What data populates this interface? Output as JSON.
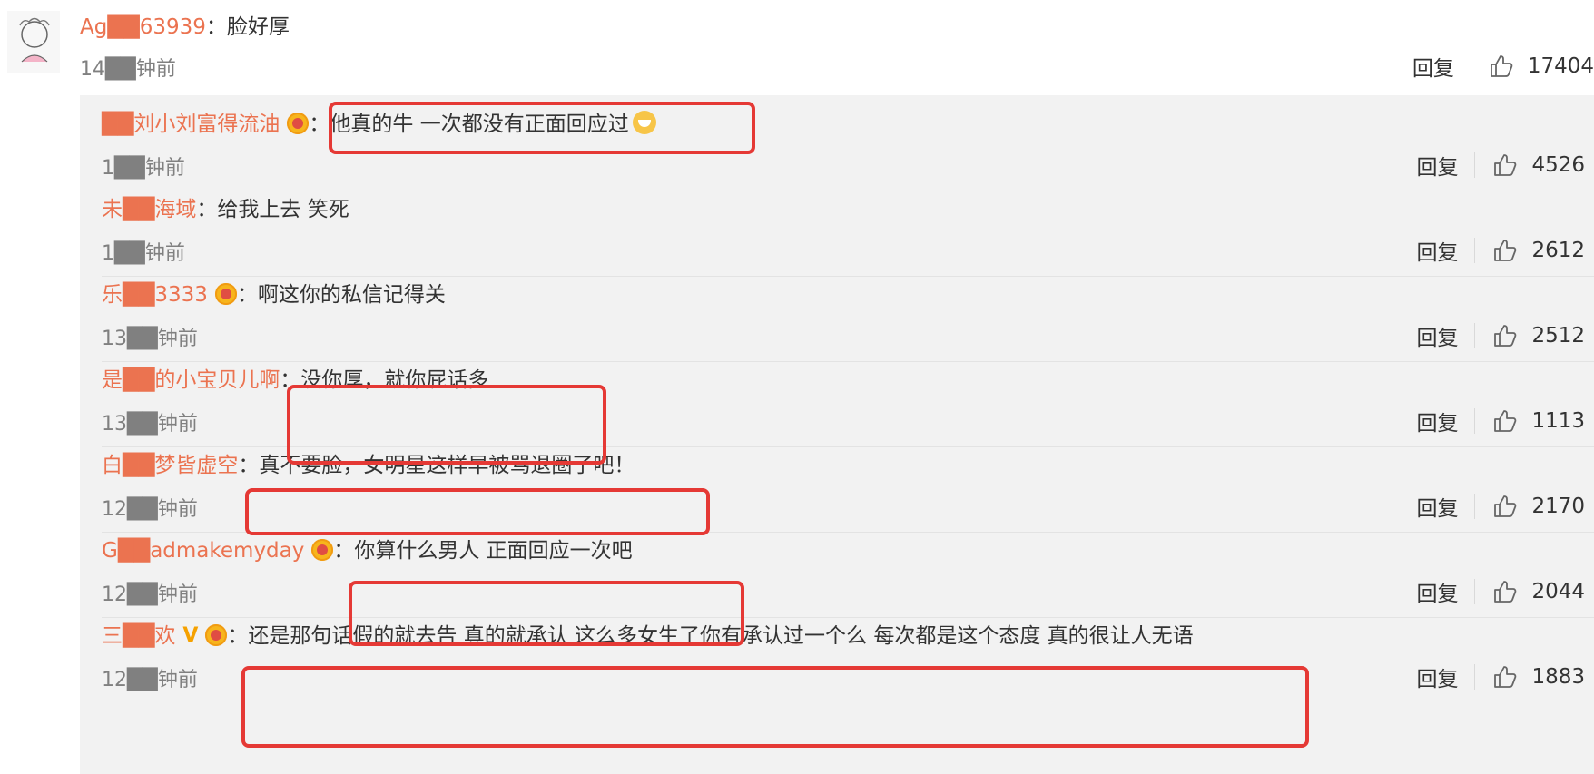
{
  "top_comment": {
    "username": "Ag██63939",
    "colon": "：",
    "content": "脸好厚",
    "time": "14██钟前",
    "reply_label": "回复",
    "likes": "17404"
  },
  "replies": [
    {
      "username": "██刘小刘富得流油",
      "colon": "：",
      "content": "他真的牛 一次都没有正面回应过",
      "time": "1██钟前",
      "reply_label": "回复",
      "likes": "4526",
      "badge": "crown-badge",
      "emoji": "sweat-smile-emoji"
    },
    {
      "username": "未██海域",
      "colon": "：",
      "content": "给我上去 笑死",
      "time": "1██钟前",
      "reply_label": "回复",
      "likes": "2612"
    },
    {
      "username": "乐██3333",
      "colon": "：",
      "content": "啊这你的私信记得关",
      "time": "13██钟前",
      "reply_label": "回复",
      "likes": "2512",
      "badge": "crown-badge"
    },
    {
      "username": "是██的小宝贝儿啊",
      "colon": "：",
      "content": "没你厚，就你屁话多",
      "time": "13██钟前",
      "reply_label": "回复",
      "likes": "1113"
    },
    {
      "username": "白██梦皆虚空",
      "colon": "：",
      "content": "真不要脸，女明星这样早被骂退圈了吧！",
      "time": "12██钟前",
      "reply_label": "回复",
      "likes": "2170"
    },
    {
      "username": "G██admakemyday",
      "colon": "：",
      "content": "你算什么男人 正面回应一次吧",
      "time": "12██钟前",
      "reply_label": "回复",
      "likes": "2044",
      "badge": "crown-badge"
    },
    {
      "username": "三██欢",
      "colon": "：",
      "content": "还是那句话假的就去告 真的就承认 这么多女生了你有承认过一个么 每次都是这个态度 真的很让人无语",
      "time": "12██钟前",
      "reply_label": "回复",
      "likes": "1883",
      "badge": "crown-badge",
      "verified": "V"
    }
  ],
  "colors": {
    "username": "#eb7350",
    "highlight": "#e53935",
    "reply_bg": "#f2f2f2"
  }
}
